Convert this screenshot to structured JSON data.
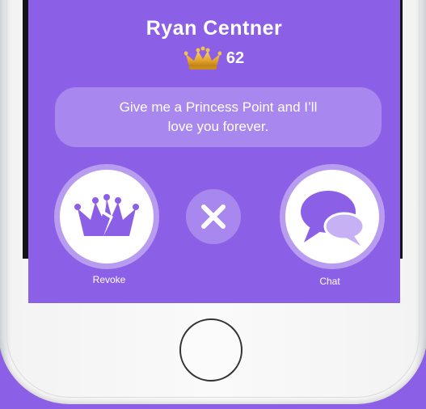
{
  "profile": {
    "name": "Ryan Centner",
    "score": "62",
    "message": "Give me a Princess Point and I’ll love you forever."
  },
  "actions": {
    "revoke_label": "Revoke",
    "chat_label": "Chat"
  },
  "icons": {
    "score": "crown-icon",
    "revoke": "broken-crown-icon",
    "close": "close-icon",
    "chat": "chat-bubbles-icon"
  },
  "colors": {
    "background": "#8c60e6",
    "bubble": "#a887ee",
    "ring": "#b79cef",
    "crown_gold": "#e8b23a"
  }
}
